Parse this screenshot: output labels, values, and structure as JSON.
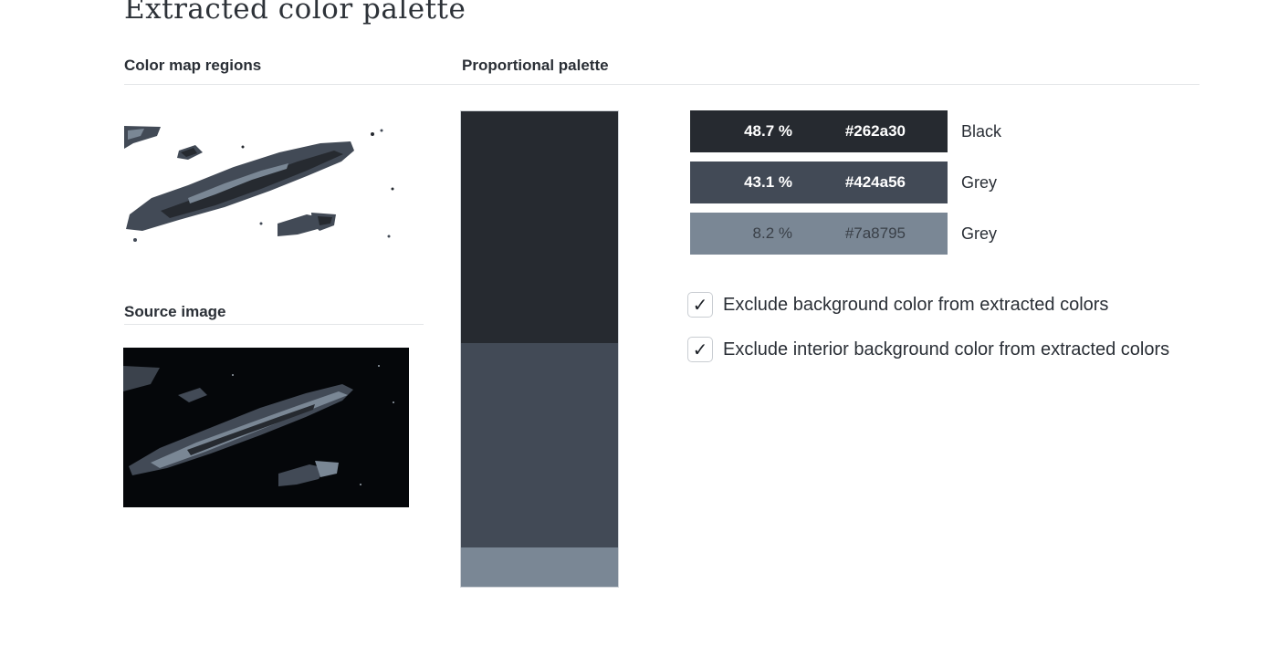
{
  "page": {
    "title": "Extracted color palette"
  },
  "sections": {
    "color_map_regions": "Color map regions",
    "proportional_palette": "Proportional palette",
    "source_image": "Source image"
  },
  "palette": [
    {
      "percent": "48.7 %",
      "hex": "#262a30",
      "name": "Black",
      "fraction": 0.487,
      "text_color": "#ffffff"
    },
    {
      "percent": "43.1 %",
      "hex": "#424a56",
      "name": "Grey",
      "fraction": 0.431,
      "text_color": "#ffffff"
    },
    {
      "percent": "8.2 %",
      "hex": "#7a8795",
      "name": "Grey",
      "fraction": 0.082,
      "text_color": "#3a4048"
    }
  ],
  "options": [
    {
      "label": "Exclude background color from extracted colors",
      "checked": true,
      "mark": "✓"
    },
    {
      "label": "Exclude interior background color from extracted colors",
      "checked": true,
      "mark": "✓"
    }
  ],
  "icons": {
    "checkbox_mark": "checkmark-icon"
  }
}
